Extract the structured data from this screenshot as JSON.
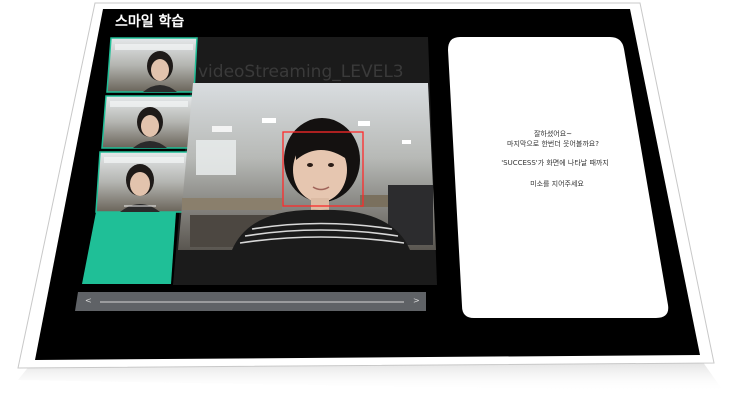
{
  "app": {
    "title": "스마일 학습"
  },
  "stream": {
    "label": "videoStreaming_LEVEL3"
  },
  "instructions": {
    "line1": "잘하셨어요~",
    "line2": "마지막으로 한번더 웃어볼까요?",
    "line3": "'SUCCESS'가 화면에 나타날 때까지",
    "line4": "미소를 지어주세요"
  },
  "scrollbar": {
    "left_arrow": "<",
    "right_arrow": ">"
  },
  "colors": {
    "accent": "#1fbf97",
    "background": "#000000",
    "face_box": "#ff2a2a",
    "panel": "#ffffff"
  },
  "icons": {
    "left": "chevron-left-icon",
    "right": "chevron-right-icon"
  }
}
